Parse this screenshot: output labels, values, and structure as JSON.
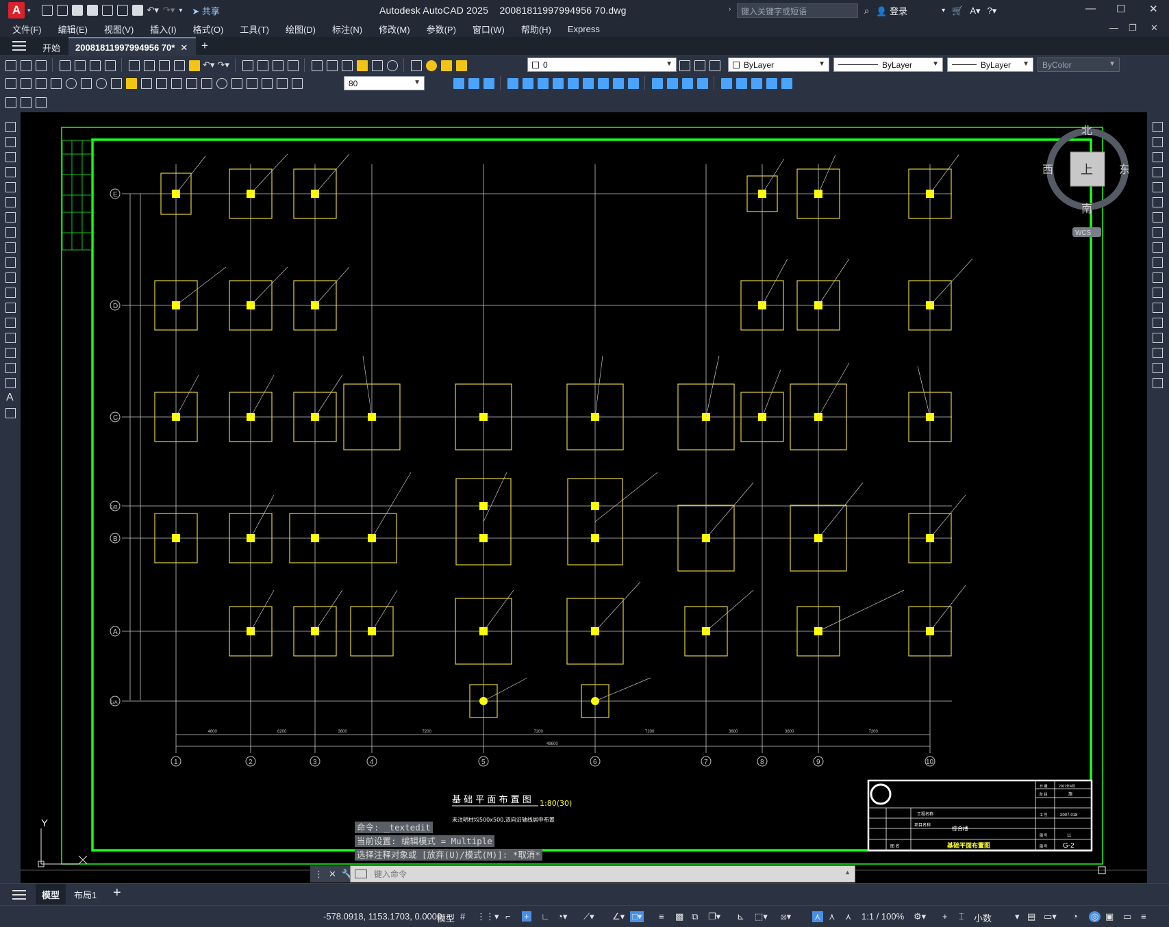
{
  "app": {
    "title": "Autodesk AutoCAD 2025",
    "filename": "20081811997994956 70.dwg",
    "share": "共享",
    "search_placeholder": "键入关键字或短语",
    "login": "登录",
    "logo": "A"
  },
  "menu": [
    "文件(F)",
    "编辑(E)",
    "视图(V)",
    "插入(I)",
    "格式(O)",
    "工具(T)",
    "绘图(D)",
    "标注(N)",
    "修改(M)",
    "参数(P)",
    "窗口(W)",
    "帮助(H)",
    "Express"
  ],
  "tabs": {
    "start": "开始",
    "doc": "20081811997994956 70*",
    "add": "+"
  },
  "toolbar": {
    "layer_value": "0",
    "color": "ByLayer",
    "linetype": "ByLayer",
    "lineweight": "ByLayer",
    "plotstyle": "ByColor",
    "dimscale": "80"
  },
  "viewcube": {
    "north": "北",
    "south": "南",
    "east": "东",
    "west": "西",
    "top": "上",
    "wcs": "WCS"
  },
  "drawing": {
    "title": "基 础 平 面 布 置 图",
    "scale": "1:80(30)",
    "note": "未注明柱均500x500,双向沿轴线居中布置",
    "axes_num": [
      "1",
      "2",
      "3",
      "4",
      "5",
      "6",
      "7",
      "8",
      "9",
      "10"
    ],
    "axes_letter": [
      "E",
      "D",
      "C",
      "1/B",
      "B",
      "A",
      "1/A"
    ],
    "total_dim": "49600",
    "spans": [
      "4800",
      "6200",
      "3600",
      "7200",
      "7200",
      "7200",
      "3600",
      "3600",
      "7200"
    ],
    "tb_project": "综合楼",
    "tb_drawing": "基础平面布置图",
    "tb_no": "G-2",
    "tb_date": "2007年4月",
    "tb_code": "2007-018",
    "tb_sheet": "11",
    "tb_stage": "施",
    "tb_left": "工程名称",
    "tb_left2": "项目名称",
    "tb_left3": "图 名",
    "tb_r1": "日 期",
    "tb_r2": "阶 段",
    "tb_r3": "工 号",
    "tb_r4": "图 号",
    "tb_r5": "图 号"
  },
  "command": {
    "line1": "命令: _textedit",
    "line2": "当前设置: 编辑模式 = Multiple",
    "line3": "选择注释对象或 [放弃(U)/模式(M)]: *取消*",
    "placeholder": "键入命令"
  },
  "layouts": {
    "model": "模型",
    "layout1": "布局1",
    "add": "+"
  },
  "status": {
    "coords": "-578.0918, 1153.1703, 0.0000",
    "model": "模型",
    "scale": "1:1 / 100%",
    "units": "小数"
  },
  "ucs": {
    "y": "Y"
  }
}
